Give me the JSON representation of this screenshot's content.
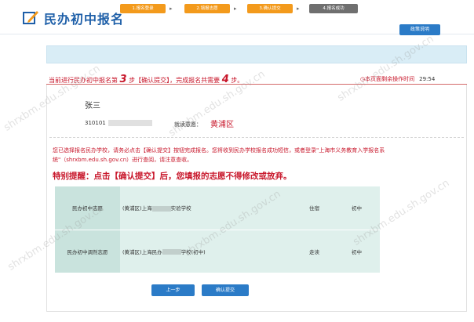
{
  "header": {
    "title": "民办初中报名",
    "help_label": "政策说明"
  },
  "steps": [
    {
      "label": "1.报名登录",
      "state": "done"
    },
    {
      "label": "2.填报志愿",
      "state": "done"
    },
    {
      "label": "3.确认提交",
      "state": "active"
    },
    {
      "label": "4.报名成功",
      "state": "todo"
    }
  ],
  "progress": {
    "prefix": "当前进行民办初中报名第",
    "current_step": "3",
    "middle": "步【确认提交】，完成报名共需要",
    "total_steps": "4",
    "suffix": "步。"
  },
  "timer": {
    "label": "本页面剩余操作时间",
    "value": "29:54"
  },
  "student": {
    "name": "张三",
    "id_prefix": "310101",
    "district_label": "就读意愿：",
    "district_value": "黄浦区"
  },
  "notice": "您已选择报名民办学校，请务必点击【确认提交】按钮完成报名。您将收到民办学校报名成功短信，或者登录\"上海市义务教育入学报名系统\"（shrxbm.edu.sh.gov.cn）进行查阅，请注意查收。",
  "warning": "特别提醒：点击【确认提交】后，您填报的志愿不得修改或放弃。",
  "choices": [
    {
      "label": "民办初中志愿",
      "school_prefix": "(黄浦区)上海",
      "school_suffix": "实验学校",
      "mode": "住宿",
      "level": "初中"
    },
    {
      "label": "民办初中调剂志愿",
      "school_prefix": "(黄浦区)上海民办",
      "school_suffix": "学校(初中)",
      "mode": "走读",
      "level": "初中"
    }
  ],
  "buttons": {
    "prev": "上一步",
    "submit": "确认提交"
  },
  "watermark": "shrxbm.edu.sh.gov.cn"
}
